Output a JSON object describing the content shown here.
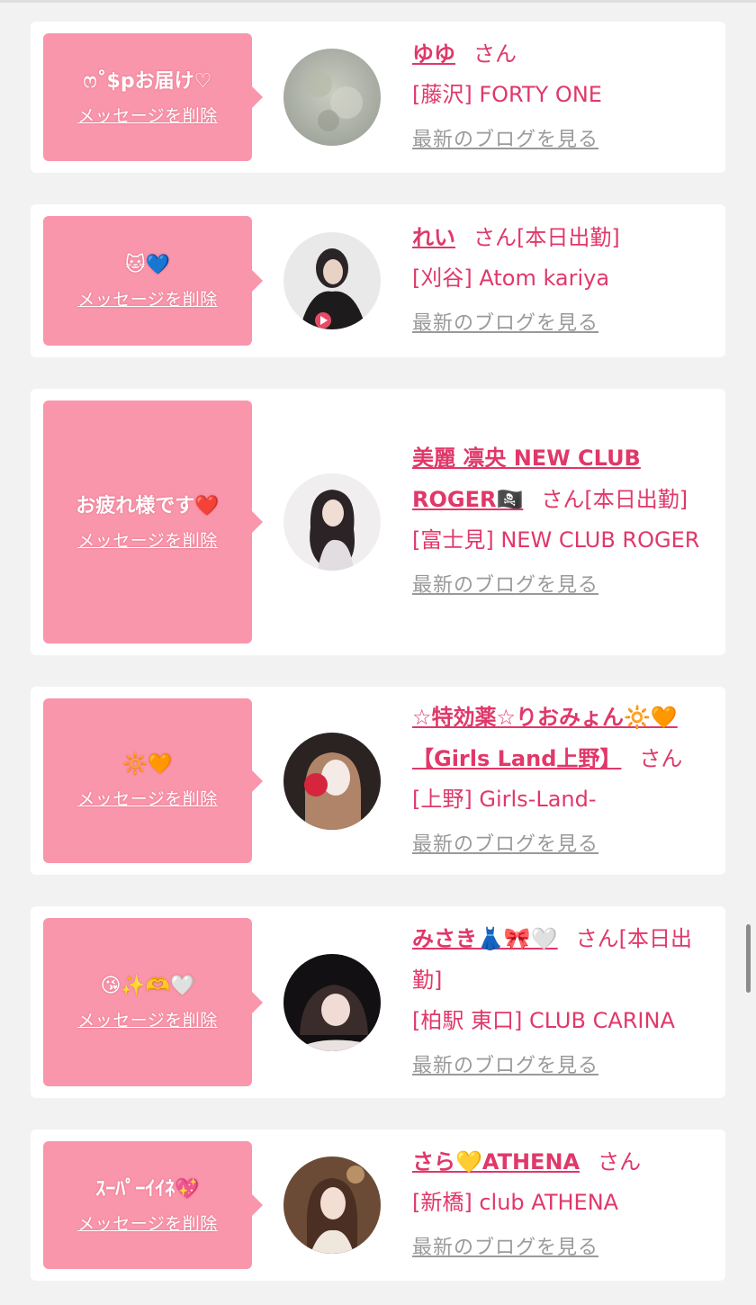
{
  "messages": [
    {
      "message": "ෆ˚$pお届け♡",
      "delete_label": "メッセージを削除",
      "name": "ゆゆ",
      "suffix": "さん",
      "shop": "[藤沢] FORTY ONE",
      "blog_label": "最新のブログを見る"
    },
    {
      "message": "🐱💙",
      "delete_label": "メッセージを削除",
      "name": "れい",
      "suffix": "さん[本日出勤]",
      "shop": "[刈谷] Atom kariya",
      "blog_label": "最新のブログを見る"
    },
    {
      "message": "お疲れ様です❤️",
      "delete_label": "メッセージを削除",
      "name": "美麗 凛央 NEW CLUB ROGER🏴‍☠️",
      "suffix": "さん[本日出勤]",
      "shop": "[富士見] NEW CLUB ROGER",
      "blog_label": "最新のブログを見る"
    },
    {
      "message": "🔆🧡",
      "delete_label": "メッセージを削除",
      "name": "☆特効薬☆りおみょん🔆🧡【Girls Land上野】",
      "suffix": "さん",
      "shop": "[上野] Girls-Land-",
      "blog_label": "最新のブログを見る"
    },
    {
      "message": "😘✨🫶🤍",
      "delete_label": "メッセージを削除",
      "name": "みさき👗🎀🤍",
      "suffix": "さん[本日出勤]",
      "shop": "[柏駅 東口] CLUB CARINA",
      "blog_label": "最新のブログを見る"
    },
    {
      "message": "ｽｰﾊﾟｰｲｲﾈ💖",
      "delete_label": "メッセージを削除",
      "name": "さら💛ATHENA",
      "suffix": "さん",
      "shop": "[新橋] club ATHENA",
      "blog_label": "最新のブログを見る"
    }
  ],
  "colors": {
    "page_bg": "#f2f2f2",
    "bubble": "#f996ab",
    "accent": "#e0386a",
    "muted": "#9a9a9a"
  },
  "avatars": [
    "avatar-1",
    "avatar-2",
    "avatar-3",
    "avatar-4",
    "avatar-5",
    "avatar-6"
  ]
}
